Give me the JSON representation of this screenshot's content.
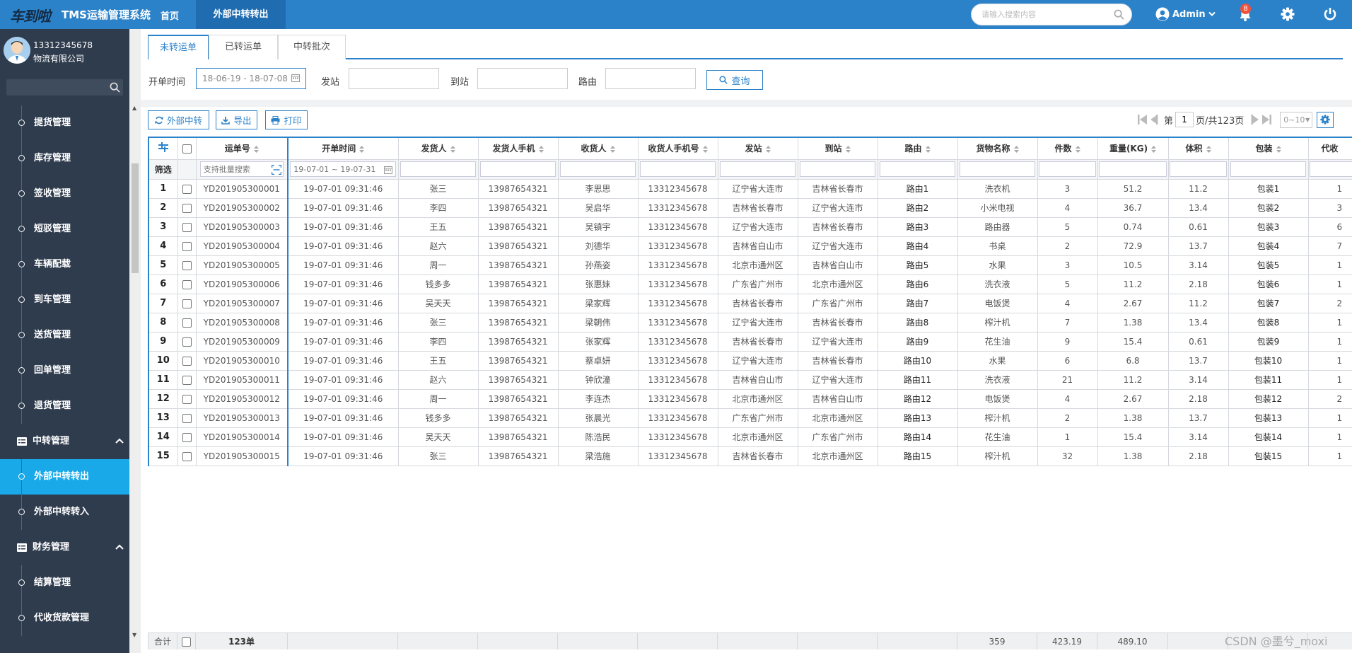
{
  "header": {
    "logo_text": "车到啦",
    "app_title": "TMS运输管理系统",
    "nav_home": "首页",
    "nav_active_tab": "外部中转转出",
    "search_placeholder": "请输入搜索内容",
    "user_label": "Admin",
    "notification_count": "8",
    "colors": {
      "bar": "#2c82c9",
      "active_tab": "#1f6db0",
      "badge": "#f3503a"
    }
  },
  "sidebar": {
    "phone": "13312345678",
    "company": "物流有限公司",
    "search_placeholder": "",
    "items": [
      {
        "label": "提货管理",
        "type": "item"
      },
      {
        "label": "库存管理",
        "type": "item"
      },
      {
        "label": "签收管理",
        "type": "item"
      },
      {
        "label": "短驳管理",
        "type": "item"
      },
      {
        "label": "车辆配载",
        "type": "item"
      },
      {
        "label": "到车管理",
        "type": "item"
      },
      {
        "label": "送货管理",
        "type": "item"
      },
      {
        "label": "回单管理",
        "type": "item"
      },
      {
        "label": "退货管理",
        "type": "item"
      },
      {
        "label": "中转管理",
        "type": "group"
      },
      {
        "label": "外部中转转出",
        "type": "item",
        "active": true
      },
      {
        "label": "外部中转转入",
        "type": "item"
      },
      {
        "label": "财务管理",
        "type": "group"
      },
      {
        "label": "结算管理",
        "type": "item"
      },
      {
        "label": "代收货款管理",
        "type": "item"
      }
    ],
    "active_color": "#19a9e8"
  },
  "tabs": [
    "未转运单",
    "已转运单",
    "中转批次"
  ],
  "filters": {
    "date_label": "开单时间",
    "date_value": "18-06-19 - 18-07-08",
    "from_label": "发站",
    "from_value": "",
    "to_label": "到站",
    "to_value": "",
    "route_label": "路由",
    "route_value": "",
    "query_button": "查询"
  },
  "toolbar": {
    "transfer_button": "外部中转",
    "export_button": "导出",
    "print_button": "打印"
  },
  "pager": {
    "prefix": "第",
    "current_page": "1",
    "suffix": "页/共123页",
    "page_size": "0~10"
  },
  "table": {
    "columns": [
      "运单号",
      "开单时间",
      "发货人",
      "发货人手机",
      "收货人",
      "收货人手机号",
      "发站",
      "到站",
      "路由",
      "货物名称",
      "件数",
      "重量(KG)",
      "体积",
      "包装",
      "代收"
    ],
    "filter_label": "筛选",
    "filter_waybill_placeholder": "支持批量搜索",
    "filter_date_placeholder": "19-07-01 ~ 19-07-31",
    "rows": [
      {
        "no": "1",
        "waybill": "YD201905300001",
        "time": "19-07-01 09:31:46",
        "sender": "张三",
        "sender_phone": "13987654321",
        "receiver": "李思思",
        "receiver_phone": "13312345678",
        "from": "辽宁省大连市",
        "to": "吉林省长春市",
        "route": "路由1",
        "goods": "洗衣机",
        "qty": "3",
        "weight": "51.2",
        "volume": "11.2",
        "pack": "包装1",
        "cod": "1"
      },
      {
        "no": "2",
        "waybill": "YD201905300002",
        "time": "19-07-01 09:31:46",
        "sender": "李四",
        "sender_phone": "13987654321",
        "receiver": "吴启华",
        "receiver_phone": "13312345678",
        "from": "吉林省长春市",
        "to": "辽宁省大连市",
        "route": "路由2",
        "goods": "小米电视",
        "qty": "4",
        "weight": "36.7",
        "volume": "13.4",
        "pack": "包装2",
        "cod": "3"
      },
      {
        "no": "3",
        "waybill": "YD201905300003",
        "time": "19-07-01 09:31:46",
        "sender": "王五",
        "sender_phone": "13987654321",
        "receiver": "吴镇宇",
        "receiver_phone": "13312345678",
        "from": "辽宁省大连市",
        "to": "吉林省长春市",
        "route": "路由3",
        "goods": "路由器",
        "qty": "5",
        "weight": "0.74",
        "volume": "0.61",
        "pack": "包装3",
        "cod": "6"
      },
      {
        "no": "4",
        "waybill": "YD201905300004",
        "time": "19-07-01 09:31:46",
        "sender": "赵六",
        "sender_phone": "13987654321",
        "receiver": "刘德华",
        "receiver_phone": "13312345678",
        "from": "吉林省白山市",
        "to": "辽宁省大连市",
        "route": "路由4",
        "goods": "书桌",
        "qty": "2",
        "weight": "72.9",
        "volume": "13.7",
        "pack": "包装4",
        "cod": "7"
      },
      {
        "no": "5",
        "waybill": "YD201905300005",
        "time": "19-07-01 09:31:46",
        "sender": "周一",
        "sender_phone": "13987654321",
        "receiver": "孙燕姿",
        "receiver_phone": "13312345678",
        "from": "北京市通州区",
        "to": "吉林省白山市",
        "route": "路由5",
        "goods": "水果",
        "qty": "3",
        "weight": "10.5",
        "volume": "3.14",
        "pack": "包装5",
        "cod": "1"
      },
      {
        "no": "6",
        "waybill": "YD201905300006",
        "time": "19-07-01 09:31:46",
        "sender": "钱多多",
        "sender_phone": "13987654321",
        "receiver": "张惠妹",
        "receiver_phone": "13312345678",
        "from": "广东省广州市",
        "to": "北京市通州区",
        "route": "路由6",
        "goods": "洗衣液",
        "qty": "5",
        "weight": "11.2",
        "volume": "2.18",
        "pack": "包装6",
        "cod": "1"
      },
      {
        "no": "7",
        "waybill": "YD201905300007",
        "time": "19-07-01 09:31:46",
        "sender": "吴天天",
        "sender_phone": "13987654321",
        "receiver": "梁家辉",
        "receiver_phone": "13312345678",
        "from": "吉林省长春市",
        "to": "广东省广州市",
        "route": "路由7",
        "goods": "电饭煲",
        "qty": "4",
        "weight": "2.67",
        "volume": "11.2",
        "pack": "包装7",
        "cod": "2"
      },
      {
        "no": "8",
        "waybill": "YD201905300008",
        "time": "19-07-01 09:31:46",
        "sender": "张三",
        "sender_phone": "13987654321",
        "receiver": "梁朝伟",
        "receiver_phone": "13312345678",
        "from": "辽宁省大连市",
        "to": "吉林省长春市",
        "route": "路由8",
        "goods": "榨汁机",
        "qty": "7",
        "weight": "1.38",
        "volume": "13.4",
        "pack": "包装8",
        "cod": "1"
      },
      {
        "no": "9",
        "waybill": "YD201905300009",
        "time": "19-07-01 09:31:46",
        "sender": "李四",
        "sender_phone": "13987654321",
        "receiver": "张家辉",
        "receiver_phone": "13312345678",
        "from": "吉林省长春市",
        "to": "辽宁省大连市",
        "route": "路由9",
        "goods": "花生油",
        "qty": "9",
        "weight": "15.4",
        "volume": "0.61",
        "pack": "包装9",
        "cod": "1"
      },
      {
        "no": "10",
        "waybill": "YD201905300010",
        "time": "19-07-01 09:31:46",
        "sender": "王五",
        "sender_phone": "13987654321",
        "receiver": "蔡卓妍",
        "receiver_phone": "13312345678",
        "from": "辽宁省大连市",
        "to": "吉林省长春市",
        "route": "路由10",
        "goods": "水果",
        "qty": "6",
        "weight": "6.8",
        "volume": "13.7",
        "pack": "包装10",
        "cod": "1"
      },
      {
        "no": "11",
        "waybill": "YD201905300011",
        "time": "19-07-01 09:31:46",
        "sender": "赵六",
        "sender_phone": "13987654321",
        "receiver": "钟欣潼",
        "receiver_phone": "13312345678",
        "from": "吉林省白山市",
        "to": "辽宁省大连市",
        "route": "路由11",
        "goods": "洗衣液",
        "qty": "21",
        "weight": "11.2",
        "volume": "3.14",
        "pack": "包装11",
        "cod": "1"
      },
      {
        "no": "12",
        "waybill": "YD201905300012",
        "time": "19-07-01 09:31:46",
        "sender": "周一",
        "sender_phone": "13987654321",
        "receiver": "李连杰",
        "receiver_phone": "13312345678",
        "from": "北京市通州区",
        "to": "吉林省白山市",
        "route": "路由12",
        "goods": "电饭煲",
        "qty": "4",
        "weight": "2.67",
        "volume": "2.18",
        "pack": "包装12",
        "cod": "2"
      },
      {
        "no": "13",
        "waybill": "YD201905300013",
        "time": "19-07-01 09:31:46",
        "sender": "钱多多",
        "sender_phone": "13987654321",
        "receiver": "张晨光",
        "receiver_phone": "13312345678",
        "from": "广东省广州市",
        "to": "北京市通州区",
        "route": "路由13",
        "goods": "榨汁机",
        "qty": "2",
        "weight": "1.38",
        "volume": "13.7",
        "pack": "包装13",
        "cod": "1"
      },
      {
        "no": "14",
        "waybill": "YD201905300014",
        "time": "19-07-01 09:31:46",
        "sender": "吴天天",
        "sender_phone": "13987654321",
        "receiver": "陈浩民",
        "receiver_phone": "13312345678",
        "from": "北京市通州区",
        "to": "广东省广州市",
        "route": "路由14",
        "goods": "花生油",
        "qty": "1",
        "weight": "15.4",
        "volume": "3.14",
        "pack": "包装14",
        "cod": "1"
      },
      {
        "no": "15",
        "waybill": "YD201905300015",
        "time": "19-07-01 09:31:46",
        "sender": "张三",
        "sender_phone": "13987654321",
        "receiver": "梁浩施",
        "receiver_phone": "13312345678",
        "from": "吉林省长春市",
        "to": "北京市通州区",
        "route": "路由15",
        "goods": "榨汁机",
        "qty": "32",
        "weight": "1.38",
        "volume": "2.18",
        "pack": "包装15",
        "cod": "1"
      }
    ],
    "footer": {
      "label": "合计",
      "count": "123单",
      "qty_total": "359",
      "weight_total": "423.19",
      "volume_total": "489.10"
    }
  },
  "watermark": "CSDN @墨兮_moxi"
}
